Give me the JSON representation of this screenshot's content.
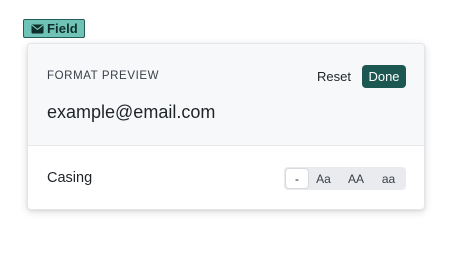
{
  "field_chip": {
    "icon": "mail-icon",
    "label": "Field",
    "background": "#6fc3b6",
    "border": "#1f5f58"
  },
  "panel": {
    "preview": {
      "heading": "FORMAT PREVIEW",
      "reset_label": "Reset",
      "done_label": "Done",
      "value": "example@email.com"
    },
    "casing": {
      "label": "Casing",
      "options": [
        "-",
        "Aa",
        "AA",
        "aa"
      ],
      "selected": "-"
    }
  },
  "colors": {
    "accent": "#1d5752",
    "preview_bg": "#f7f8fa",
    "segmented_bg": "#e9ebee"
  }
}
